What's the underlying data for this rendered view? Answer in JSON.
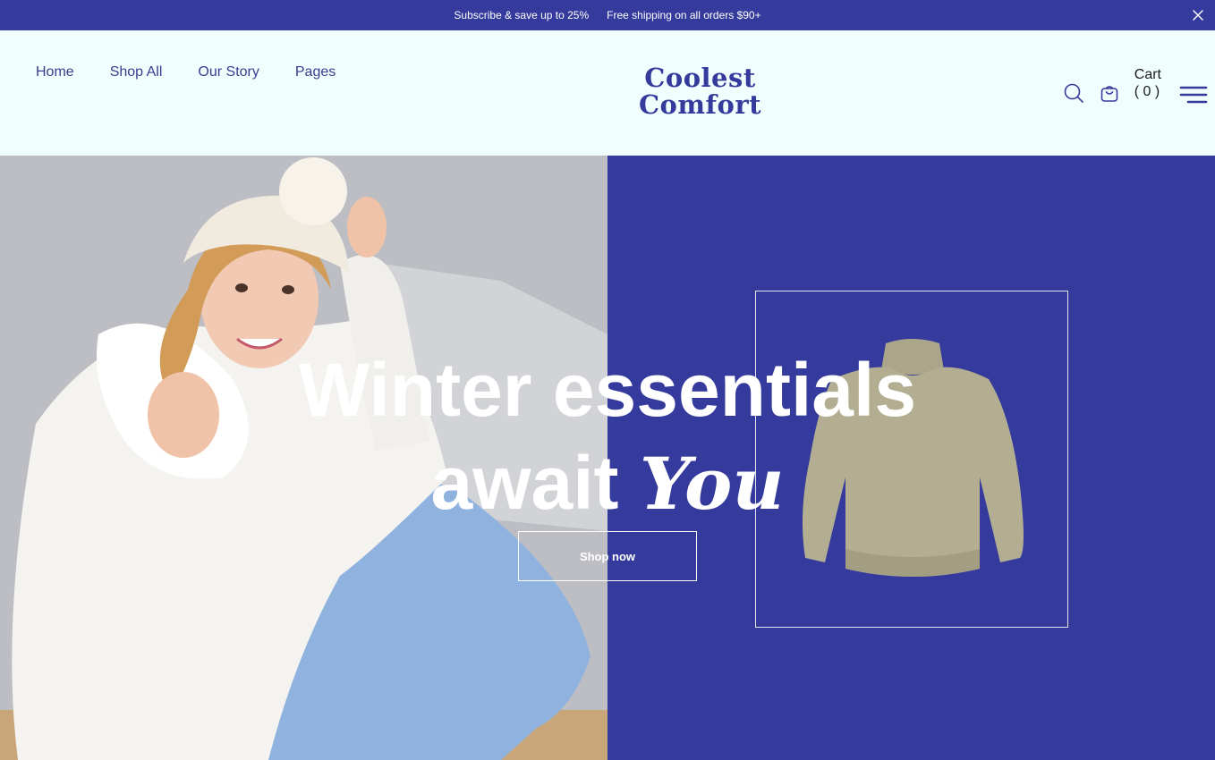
{
  "announcement": {
    "messages": [
      "Subscribe & save up to 25%",
      "Free shipping on all orders $90+"
    ],
    "close_icon": "close-icon"
  },
  "header": {
    "nav": [
      "Home",
      "Shop All",
      "Our Story",
      "Pages"
    ],
    "logo_line1": "Coolest",
    "logo_line2": "Comfort",
    "cart_label": "Cart",
    "cart_count": "( 0 )",
    "icons": [
      "search-icon",
      "bag-icon",
      "menu-icon"
    ]
  },
  "hero": {
    "headline_line1": "Winter essentials",
    "headline_line2_plain": "await",
    "headline_line2_script": "You",
    "cta_label": "Shop now"
  },
  "colors": {
    "primary": "#353b9c",
    "background": "#f0fffd",
    "text_on_primary": "#ffffff"
  }
}
